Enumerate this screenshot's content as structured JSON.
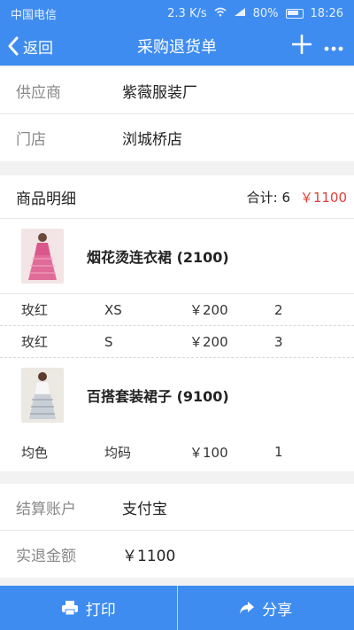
{
  "status": {
    "carrier": "中国电信",
    "speed": "2.3 K/s",
    "battery": "80%",
    "time": "18:26"
  },
  "nav": {
    "back_label": "返回",
    "title": "采购退货单"
  },
  "info": [
    {
      "label": "供应商",
      "value": "紫薇服装厂"
    },
    {
      "label": "门店",
      "value": "浏城桥店"
    }
  ],
  "details": {
    "title": "商品明细",
    "total_label": "合计:",
    "total_qty": "6",
    "total_amount": "￥1100",
    "products": [
      {
        "name": "烟花烫连衣裙 (2100)",
        "skus": [
          {
            "color": "玫红",
            "size": "XS",
            "price": "￥200",
            "qty": "2"
          },
          {
            "color": "玫红",
            "size": "S",
            "price": "￥200",
            "qty": "3"
          }
        ]
      },
      {
        "name": "百搭套装裙子 (9100)",
        "skus": [
          {
            "color": "均色",
            "size": "均码",
            "price": "￥100",
            "qty": "1"
          }
        ]
      }
    ]
  },
  "settlement": [
    {
      "label": "结算账户",
      "value": "支付宝"
    },
    {
      "label": "实退金额",
      "value": "￥1100"
    }
  ],
  "actions": {
    "print_label": "打印",
    "share_label": "分享"
  },
  "colors": {
    "primary": "#3f8cf0",
    "accent_red": "#e0403b"
  }
}
